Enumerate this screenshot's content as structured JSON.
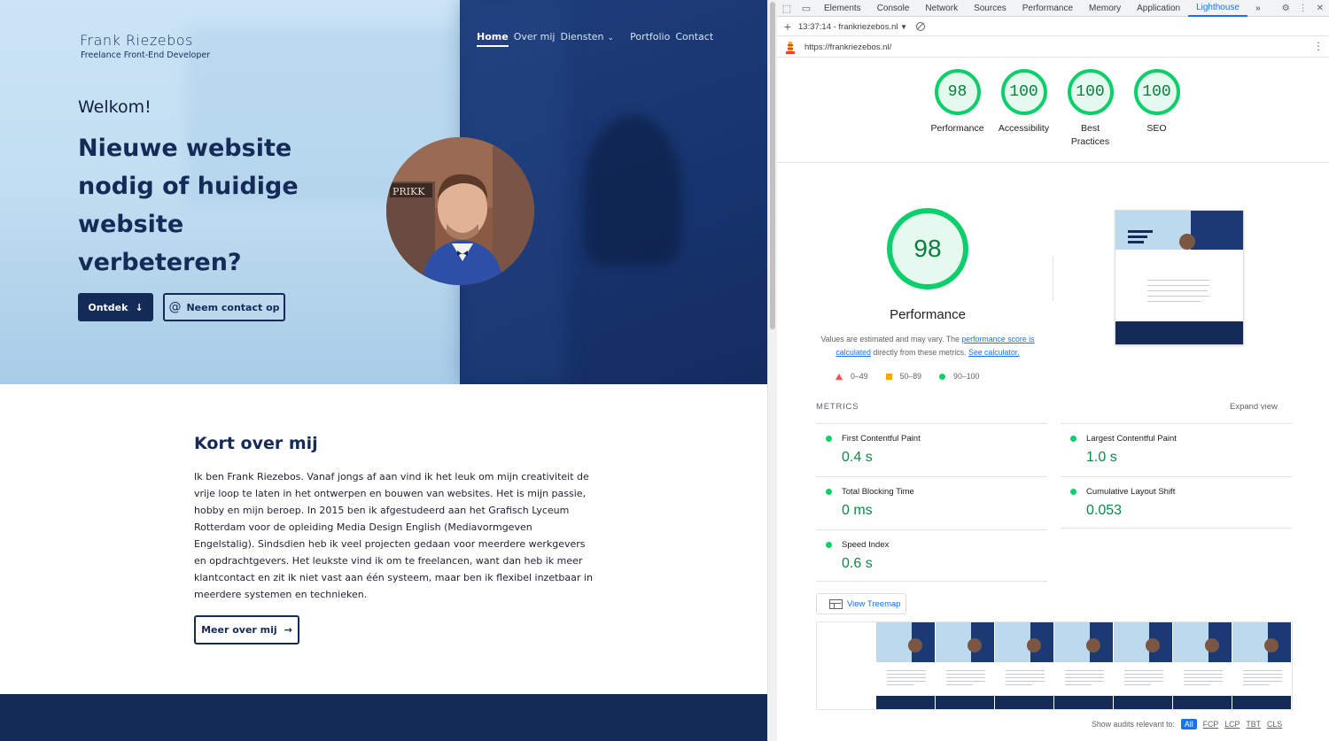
{
  "site": {
    "logo_name": "Frank Riezebos",
    "logo_sub": "Freelance Front-End Developer",
    "nav": [
      "Home",
      "Over mij",
      "Diensten",
      "Portfolio",
      "Contact"
    ],
    "welcome": "Welkom!",
    "headline": "Nieuwe website nodig of huidige website verbeteren?",
    "btn_primary": "Ontdek",
    "btn_outline": "Neem contact op",
    "about_title": "Kort over mij",
    "about_text": "Ik ben Frank Riezebos. Vanaf jongs af aan vind ik het leuk om mijn creativiteit de vrije loop te laten in het ontwerpen en bouwen van websites. Het is mijn passie, hobby en mijn beroep. In 2015 ben ik afgestudeerd aan het Grafisch Lyceum Rotterdam voor de opleiding Media Design English (Mediavormgeven Engelstalig). Sindsdien heb ik veel projecten gedaan voor meerdere werkgevers en opdrachtgevers. Het leukste vind ik om te freelancen, want dan heb ik meer klantcontact en zit ik niet vast aan één systeem, maar ben ik flexibel inzetbaar in meerdere systemen en technieken.",
    "btn_more": "Meer over mij",
    "photo_sign": "PRIKK",
    "colors": {
      "navy": "#142a57",
      "hero_light": "#cbe4f6"
    }
  },
  "devtools": {
    "tabs": [
      "Elements",
      "Console",
      "Network",
      "Sources",
      "Performance",
      "Memory",
      "Application",
      "Lighthouse"
    ],
    "active_tab": "Lighthouse",
    "report_select": "13:37:14 - frankriezebos.nl",
    "url": "https://frankriezebos.nl/",
    "scores": [
      {
        "label": "Performance",
        "value": "98"
      },
      {
        "label": "Accessibility",
        "value": "100"
      },
      {
        "label": "Best Practices",
        "value": "100"
      },
      {
        "label": "SEO",
        "value": "100"
      }
    ],
    "perf_score": "98",
    "perf_title": "Performance",
    "note_pre": "Values are estimated and may vary. The ",
    "note_link1": "performance score is calculated",
    "note_mid": " directly from these metrics. ",
    "note_link2": "See calculator.",
    "legend": [
      "0–49",
      "50–89",
      "90–100"
    ],
    "metrics_header": "METRICS",
    "expand_view": "Expand view",
    "metrics": [
      {
        "name": "First Contentful Paint",
        "value": "0.4 s"
      },
      {
        "name": "Largest Contentful Paint",
        "value": "1.0 s"
      },
      {
        "name": "Total Blocking Time",
        "value": "0 ms"
      },
      {
        "name": "Cumulative Layout Shift",
        "value": "0.053"
      },
      {
        "name": "Speed Index",
        "value": "0.6 s"
      }
    ],
    "treemap": "View Treemap",
    "audits_label": "Show audits relevant to:",
    "audit_chips": [
      "All",
      "FCP",
      "LCP",
      "TBT",
      "CLS"
    ],
    "colors": {
      "pass": "#0cce6b",
      "average": "#ffa400",
      "fail": "#ff4e42",
      "link": "#1a73e8"
    }
  }
}
